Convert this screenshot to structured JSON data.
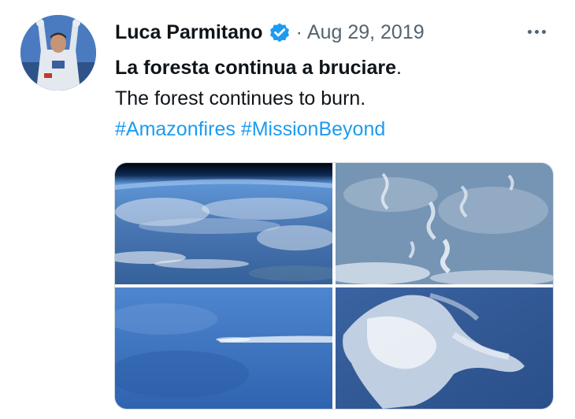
{
  "tweet": {
    "author_name": "Luca Parmitano",
    "separator": "·",
    "date": "Aug 29, 2019",
    "text_bold": "La foresta continua a bruciare",
    "text_bold_suffix": ".",
    "text_line2": "The forest continues to burn.",
    "hashtags": [
      "#Amazonfires",
      "#MissionBeyond"
    ]
  },
  "icons": {
    "verified": "verified-badge-icon",
    "more": "more-options-icon"
  },
  "colors": {
    "text": "#0f1419",
    "secondary": "#536471",
    "link": "#1d9bf0",
    "verified": "#1d9bf0",
    "border": "#cfd9de"
  }
}
